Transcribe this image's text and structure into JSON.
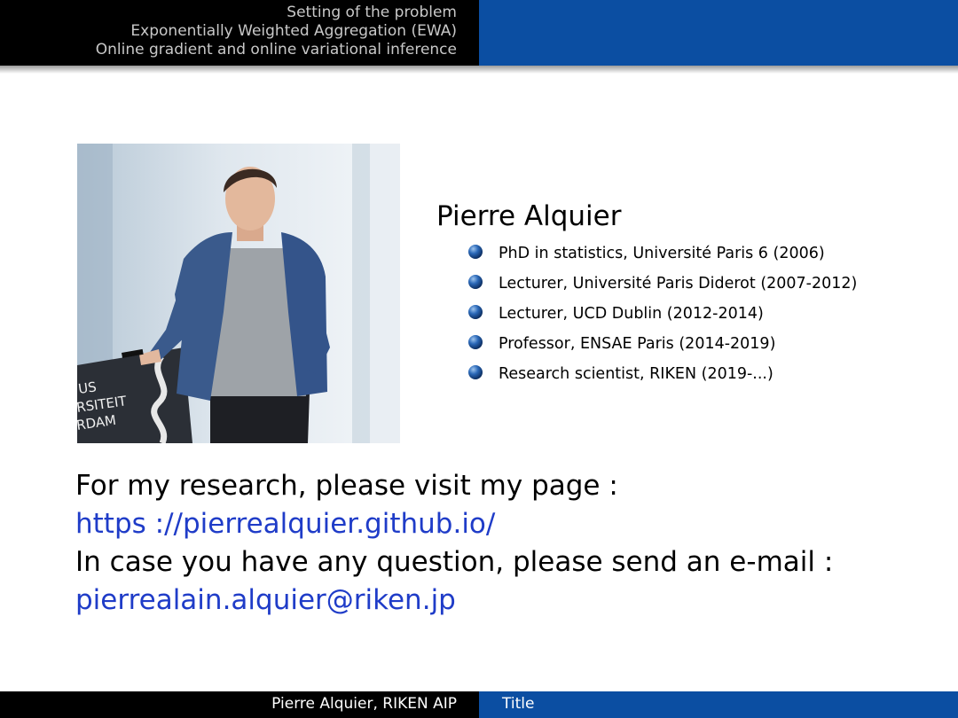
{
  "header": {
    "sections": [
      "Setting of the problem",
      "Exponentially Weighted Aggregation (EWA)",
      "Online gradient and online variational inference"
    ]
  },
  "profile": {
    "name": "Pierre Alquier",
    "career": [
      "PhD in statistics, Université Paris 6 (2006)",
      "Lecturer, Université Paris Diderot (2007-2012)",
      "Lecturer, UCD Dublin (2012-2014)",
      "Professor, ENSAE Paris (2014-2019)",
      "Research scientist, RIKEN (2019-...)"
    ],
    "photo_sign_text": [
      "US",
      "RSITEIT",
      "RDAM"
    ]
  },
  "contact": {
    "research_text": "For my research, please visit my page :",
    "research_link": "https ://pierrealquier.github.io/",
    "email_text": "In case you have any question, please send an e-mail :",
    "email_link": "pierrealain.alquier@riken.jp"
  },
  "footer": {
    "author": "Pierre Alquier, RIKEN AIP",
    "title": "Title"
  },
  "colors": {
    "theme_blue": "#0b4ea2",
    "link_blue": "#1f3cc8",
    "header_text": "#c8c8c8"
  }
}
